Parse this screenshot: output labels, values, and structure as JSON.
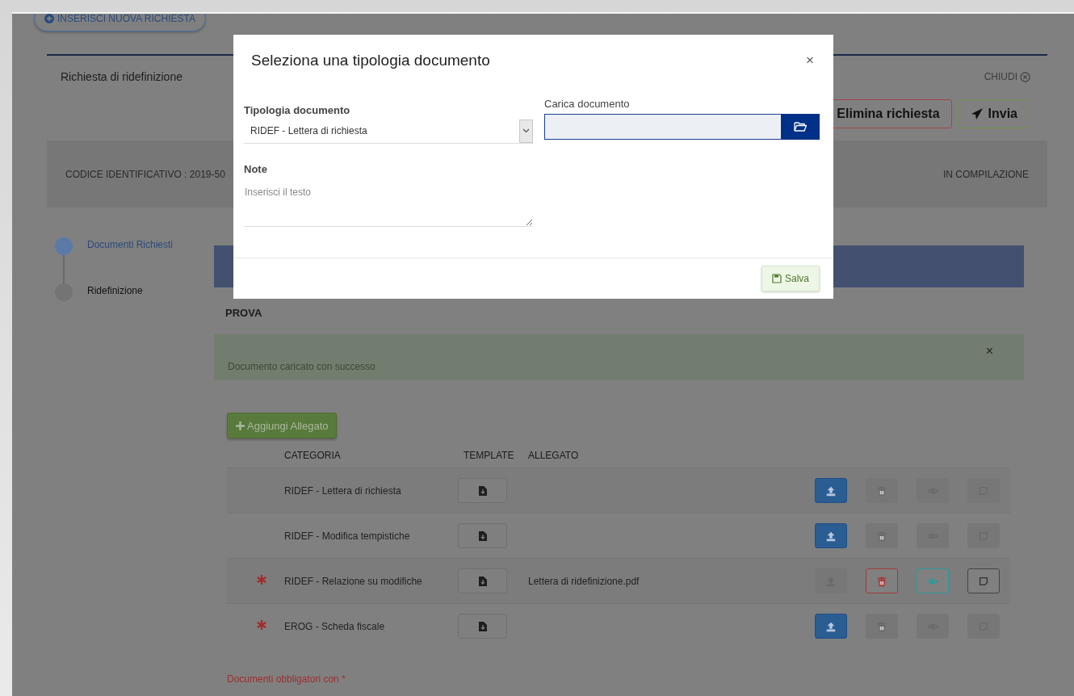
{
  "header_button": {
    "label": "INSERISCI NUOVA RICHIESTA"
  },
  "request": {
    "title": "Richiesta di ridefinizione",
    "close_label": "CHIUDI"
  },
  "actions": [
    {
      "kind": "delete",
      "label": "Elimina richiesta"
    },
    {
      "kind": "send",
      "label": "Invia"
    }
  ],
  "info": {
    "code": "CODICE IDENTIFICATIVO : 2019-50",
    "status": "IN COMPILAZIONE"
  },
  "steps": [
    {
      "label": "Documenti Richiesti",
      "selected": true
    },
    {
      "label": "Ridefinizione",
      "selected": false
    }
  ],
  "panel": {
    "section": "PROVA",
    "alert": "Documento caricato con successo",
    "alert_close": "×",
    "add_button": "Aggiungi Allegato",
    "columns": [
      "CATEGORIA",
      "TEMPLATE",
      "ALLEGATO"
    ],
    "rows": [
      {
        "required": false,
        "category": "RIDEF - Lettera di richiesta",
        "buttons": [
          {
            "kind": "upload",
            "disabled": false
          },
          {
            "kind": "delete",
            "disabled": true
          },
          {
            "kind": "view",
            "disabled": true
          },
          {
            "kind": "note",
            "disabled": true
          }
        ]
      },
      {
        "required": false,
        "category": "RIDEF - Modifica tempistiche",
        "buttons": [
          {
            "kind": "upload",
            "disabled": false
          },
          {
            "kind": "delete",
            "disabled": true
          },
          {
            "kind": "view",
            "disabled": true
          },
          {
            "kind": "note",
            "disabled": true
          }
        ]
      },
      {
        "required": true,
        "category": "RIDEF - Relazione su modifiche",
        "attachment": "Lettera di ridefinizione.pdf",
        "buttons": [
          {
            "kind": "upload",
            "disabled": true
          },
          {
            "kind": "delete",
            "disabled": false
          },
          {
            "kind": "view",
            "disabled": false
          },
          {
            "kind": "note",
            "disabled": false
          }
        ]
      },
      {
        "required": true,
        "category": "EROG - Scheda fiscale",
        "buttons": [
          {
            "kind": "upload",
            "disabled": false
          },
          {
            "kind": "delete",
            "disabled": true
          },
          {
            "kind": "view",
            "disabled": true
          },
          {
            "kind": "note",
            "disabled": true
          }
        ]
      }
    ],
    "footnote": "Documenti obbligatori con *"
  },
  "modal": {
    "title": "Seleziona una tipologia documento",
    "close": "×",
    "type_label": "Tipologia documento",
    "type_value": "RIDEF - Lettera di richiesta",
    "upload_label": "Carica documento",
    "note_label": "Note",
    "note_placeholder": "Inserisci il testo",
    "save_button": "Salva"
  }
}
